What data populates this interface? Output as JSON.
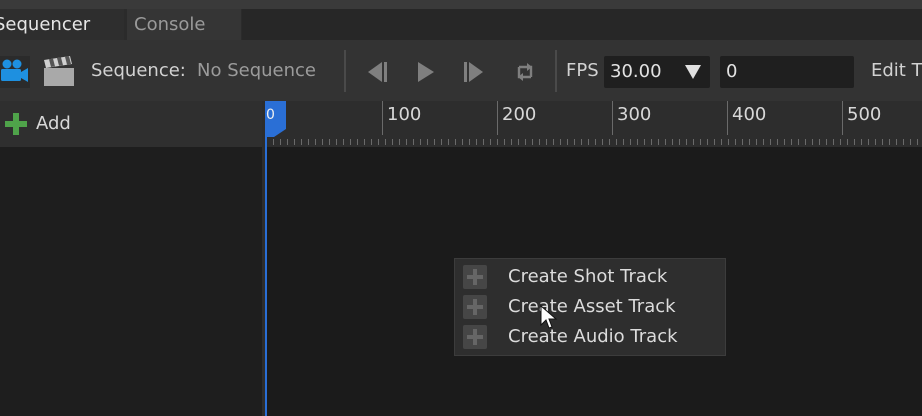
{
  "tabs": [
    {
      "label": "Sequencer",
      "active": true
    },
    {
      "label": "Console",
      "active": false
    }
  ],
  "toolbar": {
    "camera_icon": "camera-icon",
    "clapper_icon": "clapperboard-icon",
    "sequence_label": "Sequence:",
    "sequence_value": "No Sequence",
    "transport_icons": [
      "step-back-icon",
      "play-icon",
      "step-forward-icon",
      "loop-icon"
    ],
    "fps_label": "FPS",
    "fps_value": "30.00",
    "frame_value": "0",
    "edit_label": "Edit T"
  },
  "left_panel": {
    "add_label": "Add"
  },
  "ruler": {
    "playhead_label": "0",
    "ticks": [
      "100",
      "200",
      "300",
      "400",
      "500"
    ]
  },
  "context_menu": {
    "items": [
      {
        "label": "Create Shot Track"
      },
      {
        "label": "Create Asset Track"
      },
      {
        "label": "Create Audio Track"
      }
    ]
  },
  "colors": {
    "accent": "#2a6fd6",
    "camera_icon": "#1e90e0",
    "add_icon": "#4fa34a"
  }
}
